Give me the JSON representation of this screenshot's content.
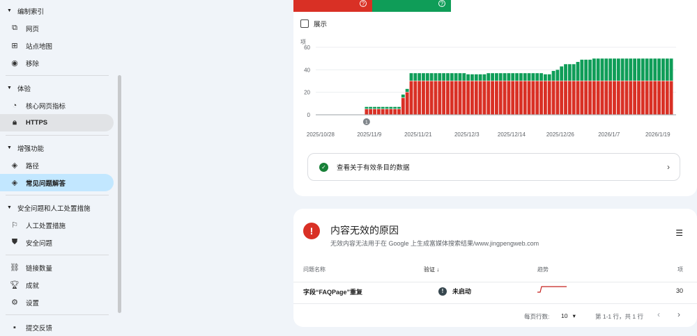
{
  "sidebar": {
    "sections": [
      {
        "label": "编制索引",
        "items": [
          {
            "label": "网页",
            "icon": "pages-icon"
          },
          {
            "label": "站点地图",
            "icon": "sitemap-icon"
          },
          {
            "label": "移除",
            "icon": "removal-icon"
          }
        ]
      },
      {
        "label": "体验",
        "items": [
          {
            "label": "核心网页指标",
            "icon": "speed-icon"
          },
          {
            "label": "HTTPS",
            "icon": "lock-icon"
          }
        ]
      },
      {
        "label": "增强功能",
        "items": [
          {
            "label": "路径",
            "icon": "layers-icon"
          },
          {
            "label": "常见问题解答",
            "icon": "layers-icon"
          }
        ]
      },
      {
        "label": "安全问题和人工处置措施",
        "items": [
          {
            "label": "人工处置措施",
            "icon": "flag-icon"
          },
          {
            "label": "安全问题",
            "icon": "shield-icon"
          }
        ]
      }
    ],
    "bottom": [
      {
        "label": "链接数量",
        "icon": "links-icon"
      },
      {
        "label": "成就",
        "icon": "trophy-icon"
      },
      {
        "label": "设置",
        "icon": "gear-icon"
      }
    ],
    "feedback": {
      "label": "提交反馈",
      "icon": "feedback-icon"
    }
  },
  "summary": {
    "invalid_color": "#d93025",
    "valid_color": "#0f9d58",
    "show_label": "展示",
    "link_label": "查看关于有效条目的数据"
  },
  "chart_data": {
    "type": "bar",
    "stacked": true,
    "ylabel": "项",
    "ylim": [
      0,
      60
    ],
    "yticks": [
      0,
      20,
      40,
      60
    ],
    "grid": true,
    "xticks": [
      "2025/10/28",
      "2025/11/9",
      "2025/11/21",
      "2025/12/3",
      "2025/12/14",
      "2025/12/26",
      "2026/1/7",
      "2026/1/19"
    ],
    "annotation": {
      "date": "2025/11/9",
      "label": "1"
    },
    "categories": [
      "2025/10/28",
      "2025/10/29",
      "2025/10/30",
      "2025/10/31",
      "2025/11/1",
      "2025/11/2",
      "2025/11/3",
      "2025/11/4",
      "2025/11/5",
      "2025/11/6",
      "2025/11/7",
      "2025/11/8",
      "2025/11/9",
      "2025/11/10",
      "2025/11/11",
      "2025/11/12",
      "2025/11/13",
      "2025/11/14",
      "2025/11/15",
      "2025/11/16",
      "2025/11/17",
      "2025/11/18",
      "2025/11/19",
      "2025/11/20",
      "2025/11/21",
      "2025/11/22",
      "2025/11/23",
      "2025/11/24",
      "2025/11/25",
      "2025/11/26",
      "2025/11/27",
      "2025/11/28",
      "2025/11/29",
      "2025/11/30",
      "2025/12/1",
      "2025/12/2",
      "2025/12/3",
      "2025/12/4",
      "2025/12/5",
      "2025/12/6",
      "2025/12/7",
      "2025/12/8",
      "2025/12/9",
      "2025/12/10",
      "2025/12/11",
      "2025/12/12",
      "2025/12/13",
      "2025/12/14",
      "2025/12/15",
      "2025/12/16",
      "2025/12/17",
      "2025/12/18",
      "2025/12/19",
      "2025/12/20",
      "2025/12/21",
      "2025/12/22",
      "2025/12/23",
      "2025/12/24",
      "2025/12/25",
      "2025/12/26",
      "2025/12/27",
      "2025/12/28",
      "2025/12/29",
      "2025/12/30",
      "2025/12/31",
      "2026/1/1",
      "2026/1/2",
      "2026/1/3",
      "2026/1/4",
      "2026/1/5",
      "2026/1/6",
      "2026/1/7",
      "2026/1/8",
      "2026/1/9",
      "2026/1/10",
      "2026/1/11",
      "2026/1/12",
      "2026/1/13",
      "2026/1/14",
      "2026/1/15",
      "2026/1/16",
      "2026/1/17",
      "2026/1/18",
      "2026/1/19",
      "2026/1/20",
      "2026/1/21",
      "2026/1/22",
      "2026/1/23"
    ],
    "series": [
      {
        "color": "#d93025",
        "values": [
          0,
          0,
          0,
          0,
          0,
          0,
          0,
          0,
          0,
          0,
          0,
          0,
          5,
          5,
          5,
          5,
          5,
          5,
          5,
          5,
          5,
          15,
          20,
          30,
          30,
          30,
          30,
          30,
          30,
          30,
          30,
          30,
          30,
          30,
          30,
          30,
          30,
          30,
          30,
          30,
          30,
          30,
          30,
          30,
          30,
          30,
          30,
          30,
          30,
          30,
          30,
          30,
          30,
          30,
          30,
          30,
          30,
          30,
          30,
          30,
          30,
          30,
          30,
          30,
          30,
          30,
          30,
          30,
          30,
          30,
          30,
          30,
          30,
          30,
          30,
          30,
          30,
          30,
          30,
          30,
          30,
          30,
          30,
          30,
          30,
          30,
          30,
          30
        ]
      },
      {
        "color": "#0f9d58",
        "values": [
          0,
          0,
          0,
          0,
          0,
          0,
          0,
          0,
          0,
          0,
          0,
          0,
          2,
          2,
          2,
          2,
          2,
          2,
          2,
          2,
          2,
          3,
          3,
          7,
          7,
          7,
          7,
          7,
          7,
          7,
          7,
          7,
          7,
          7,
          7,
          7,
          7,
          6,
          6,
          6,
          6,
          6,
          7,
          7,
          7,
          7,
          7,
          7,
          7,
          7,
          7,
          7,
          7,
          7,
          7,
          7,
          6,
          6,
          9,
          10,
          13,
          15,
          15,
          15,
          17,
          19,
          19,
          19,
          20,
          20,
          20,
          20,
          20,
          20,
          20,
          20,
          20,
          20,
          20,
          20,
          20,
          20,
          20,
          20,
          20,
          20,
          20,
          20
        ]
      }
    ]
  },
  "issues": {
    "title": "内容无效的原因",
    "subtitle": "无效内容无法用于在 Google 上生成富媒体搜索结果/www.jingpengweb.com",
    "columns": {
      "name": "问题名称",
      "validation": "验证",
      "trend": "趋势",
      "count": "项"
    },
    "rows": [
      {
        "name": "字段“FAQPage”重复",
        "status": "未启动",
        "count": "30"
      }
    ],
    "rows_per_page_label": "每页行数:",
    "rows_per_page": "10",
    "range": "第 1-1 行，共 1 行"
  }
}
